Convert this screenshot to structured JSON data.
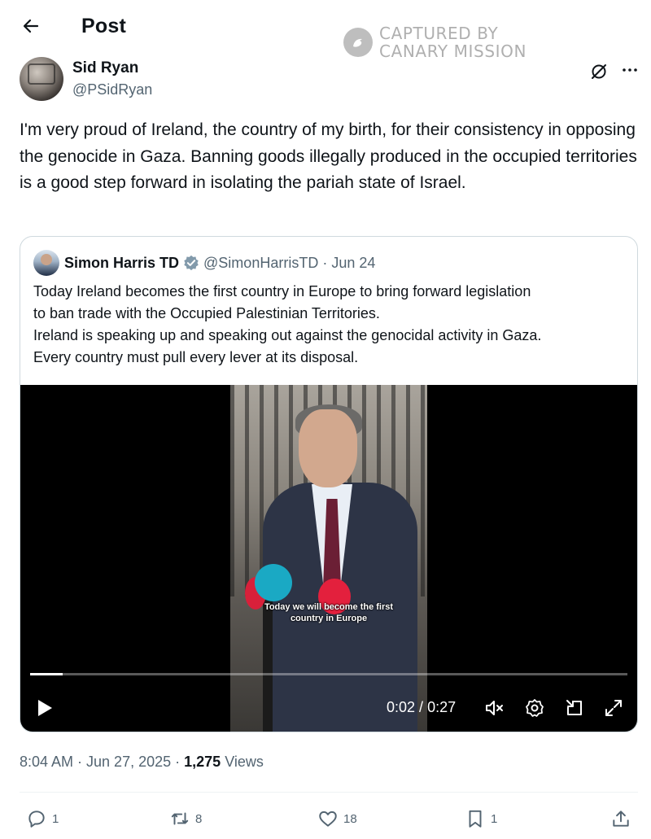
{
  "header": {
    "title": "Post",
    "back_icon": "arrow-left-icon"
  },
  "watermark": {
    "line1": "CAPTURED BY",
    "line2": "CANARY MISSION"
  },
  "post": {
    "author_name": "Sid Ryan",
    "author_handle": "@PSidRyan",
    "text": "I'm very proud of Ireland, the country of my birth, for their consistency in opposing the genocide in Gaza. Banning goods illegally produced in the occupied territories is a good step forward in isolating  the pariah state of Israel.",
    "timestamp": "8:04 AM · Jun 27, 2025",
    "meta_sep": " · ",
    "views_count": "1,275",
    "views_label": "Views"
  },
  "quote": {
    "author_name": "Simon Harris TD",
    "author_handle": "@SimonHarrisTD",
    "date": "Jun 24",
    "dot": "·",
    "text_lines": [
      "Today Ireland becomes the first country in Europe to bring forward legislation",
      "to ban trade with the Occupied Palestinian Territories.",
      "Ireland is speaking up and speaking out against the genocidal activity in Gaza.",
      "Every country must pull every lever at its disposal."
    ],
    "badge_color": "#829aab"
  },
  "video": {
    "caption_lines": [
      "Today we will become the first",
      "country in Europe"
    ],
    "current_time": "0:02",
    "duration": "0:27",
    "time_sep": " / ",
    "progress_fraction": 0.055
  },
  "actions": {
    "replies": "1",
    "reposts": "8",
    "likes": "18",
    "bookmarks": "1"
  },
  "colors": {
    "text": "#0f1419",
    "secondary": "#536471",
    "border": "#cfd9de"
  }
}
